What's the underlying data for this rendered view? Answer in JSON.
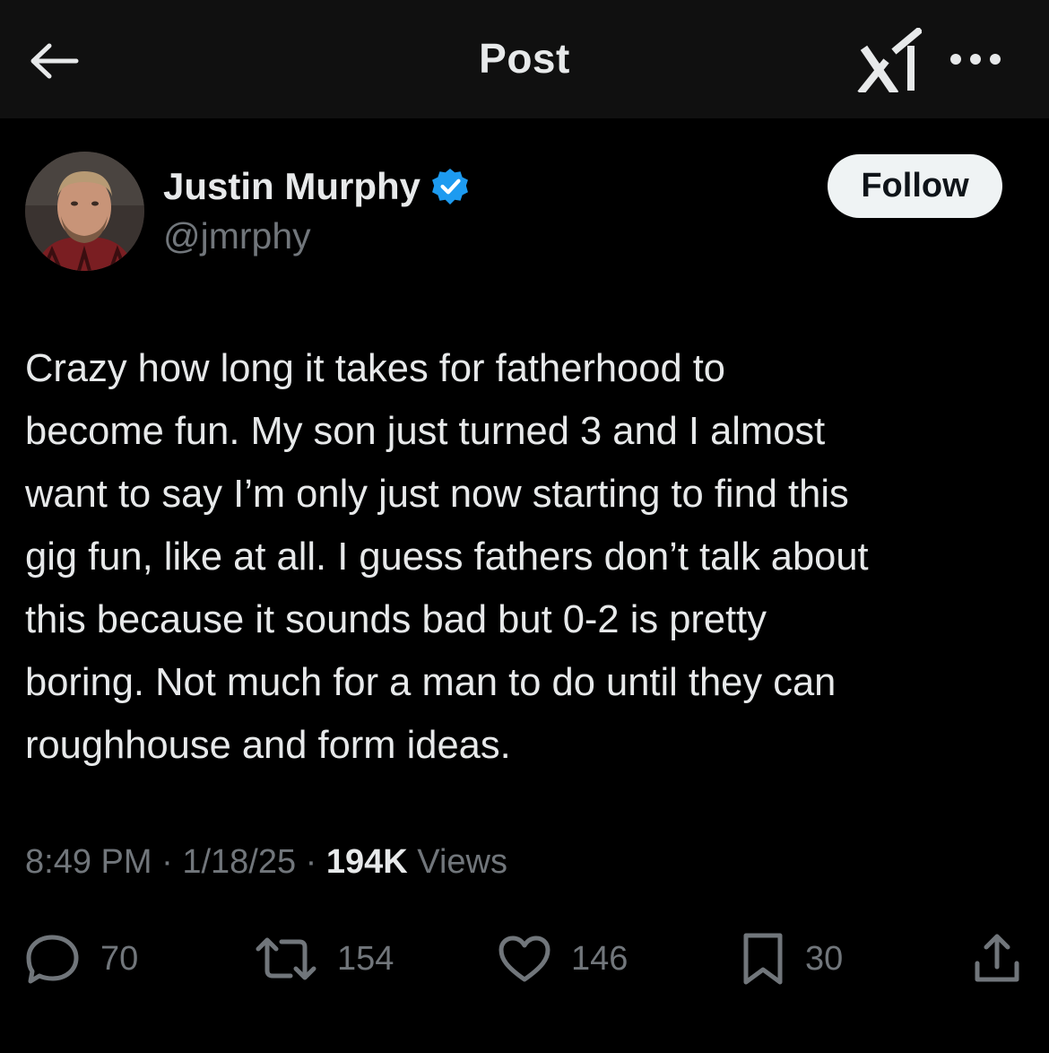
{
  "header": {
    "title": "Post",
    "back_icon": "arrow-left-icon",
    "grok_icon": "grok-icon",
    "more_icon": "more-dots-icon"
  },
  "author": {
    "display_name": "Justin Murphy",
    "handle": "@jmrphy",
    "verified": true,
    "verified_color": "#1d9bf0"
  },
  "follow_button": {
    "label": "Follow"
  },
  "post": {
    "lines": [
      "Crazy how long it takes for fatherhood to",
      "become fun. My son just turned 3 and I almost",
      "want to say I’m only just now starting to find this",
      "gig fun, like at all. I guess fathers don’t talk about",
      "this because it sounds bad but 0-2 is pretty",
      "boring. Not much for a man to do until they can",
      "roughhouse and form ideas."
    ]
  },
  "meta": {
    "time": "8:49 PM",
    "separator": " · ",
    "date": "1/18/25",
    "views_count": "194K",
    "views_label": " Views"
  },
  "actions": {
    "replies": "70",
    "reposts": "154",
    "likes": "146",
    "bookmarks": "30"
  },
  "colors": {
    "background": "#000000",
    "header_background": "#101010",
    "text_primary": "#e7e9ea",
    "text_secondary": "#71767b",
    "follow_bg": "#eff3f4",
    "follow_text": "#0f1419"
  }
}
